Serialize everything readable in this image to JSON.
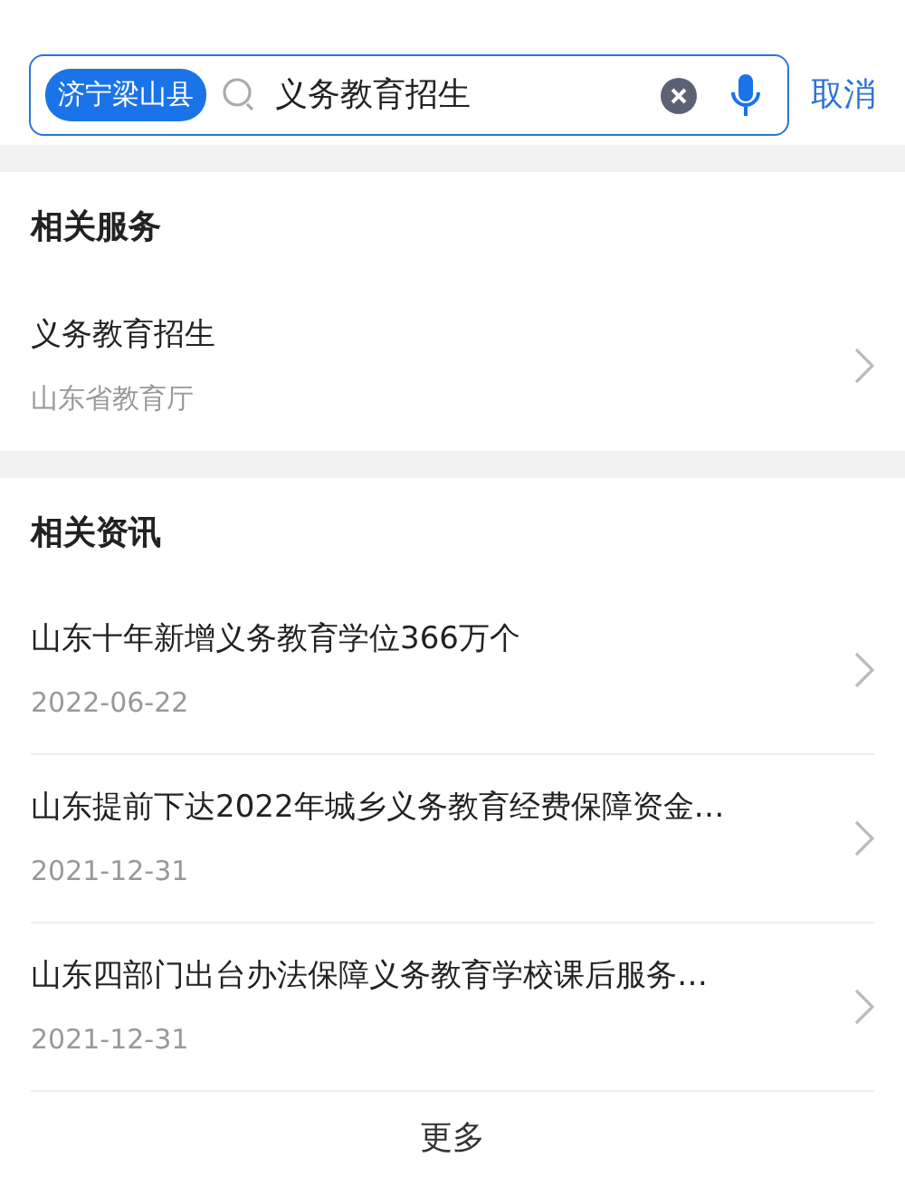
{
  "search": {
    "region": "济宁梁山县",
    "value": "义务教育招生",
    "cancel": "取消"
  },
  "services": {
    "title": "相关服务",
    "items": [
      {
        "title": "义务教育招生",
        "subtitle": "山东省教育厅"
      }
    ]
  },
  "news": {
    "title": "相关资讯",
    "items": [
      {
        "title": "山东十年新增义务教育学位366万个",
        "date": "2022-06-22"
      },
      {
        "title": "山东提前下达2022年城乡义务教育经费保障资金…",
        "date": "2021-12-31"
      },
      {
        "title": "山东四部门出台办法保障义务教育学校课后服务…",
        "date": "2021-12-31"
      }
    ],
    "more": "更多"
  }
}
